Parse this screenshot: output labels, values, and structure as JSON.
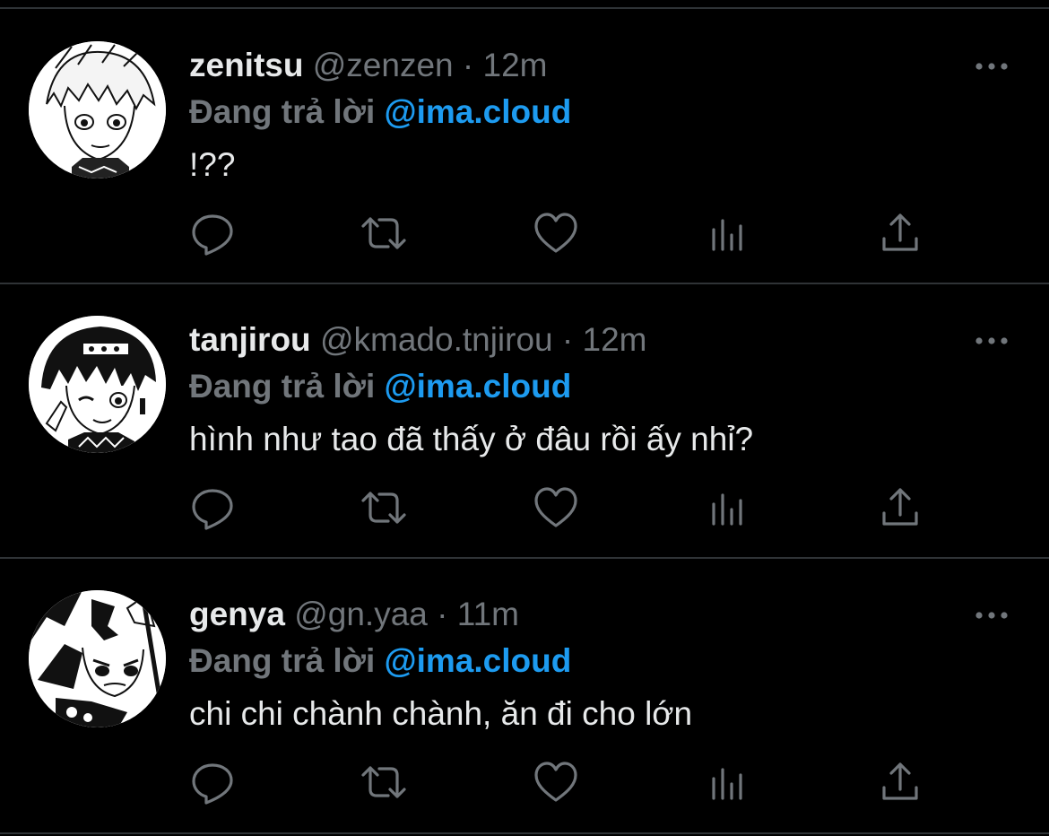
{
  "colors": {
    "background": "#000000",
    "separator": "#2f3336",
    "primary_text": "#e7e9ea",
    "secondary_text": "#71767b",
    "mention": "#1d9bf0"
  },
  "tweets": [
    {
      "name": "zenitsu",
      "handle": "@zenzen",
      "dot": "·",
      "time": "12m",
      "reply_label": "Đang trả lời",
      "reply_to": "@ima.cloud",
      "text": "!??",
      "avatar_icon": "manga-avatar-zenitsu"
    },
    {
      "name": "tanjirou",
      "handle": "@kmado.tnjirou",
      "dot": "·",
      "time": "12m",
      "reply_label": "Đang trả lời",
      "reply_to": "@ima.cloud",
      "text": "hình như tao đã thấy ở đâu rồi ấy nhỉ?",
      "avatar_icon": "manga-avatar-tanjirou"
    },
    {
      "name": "genya",
      "handle": "@gn.yaa",
      "dot": "·",
      "time": "11m",
      "reply_label": "Đang trả lời",
      "reply_to": "@ima.cloud",
      "text": "chi chi chành chành, ăn đi cho lớn",
      "avatar_icon": "manga-avatar-genya"
    }
  ],
  "action_icons": [
    "reply-icon",
    "retweet-icon",
    "like-icon",
    "analytics-icon",
    "share-icon"
  ],
  "more_icon": "more-options-icon"
}
